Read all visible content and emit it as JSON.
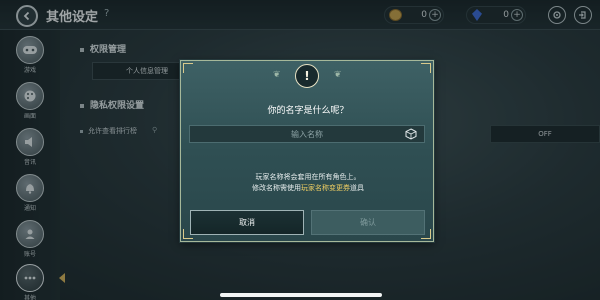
{
  "header": {
    "title": "其他设定",
    "help_icon": "?"
  },
  "resources": [
    {
      "icon": "coin-icon",
      "value": "0",
      "plus": "+"
    },
    {
      "icon": "gem-icon",
      "value": "0",
      "plus": "+"
    }
  ],
  "sidebar": {
    "items": [
      {
        "label": "游戏",
        "icon": "gamepad-icon"
      },
      {
        "label": "画面",
        "icon": "palette-icon"
      },
      {
        "label": "音讯",
        "icon": "speaker-icon"
      },
      {
        "label": "通知",
        "icon": "bell-icon"
      },
      {
        "label": "账号",
        "icon": "account-icon"
      },
      {
        "label": "其他",
        "icon": "more-icon",
        "active": true
      }
    ]
  },
  "content": {
    "section1_title": "权限管理",
    "personal_info_button": "个人信息管理",
    "section2_title": "隐私权限设置",
    "leaderboard_label": "允许查看排行榜",
    "leaderboard_value": "OFF"
  },
  "dialog": {
    "icon": "!",
    "title": "你的名字是什么呢？",
    "input_placeholder": "输入名称",
    "input_value": "",
    "desc_line1": "玩家名称将会套用在所有角色上。",
    "desc_line2_prefix": "修改名称需使用",
    "desc_line2_highlight": "玩家名称变更券",
    "desc_line2_suffix": "道具",
    "cancel_label": "取消",
    "confirm_label": "确认"
  },
  "colors": {
    "accent_gold": "#f0cf63",
    "dialog_bg": "#2f4f53",
    "dialog_border": "#a6b89a"
  }
}
